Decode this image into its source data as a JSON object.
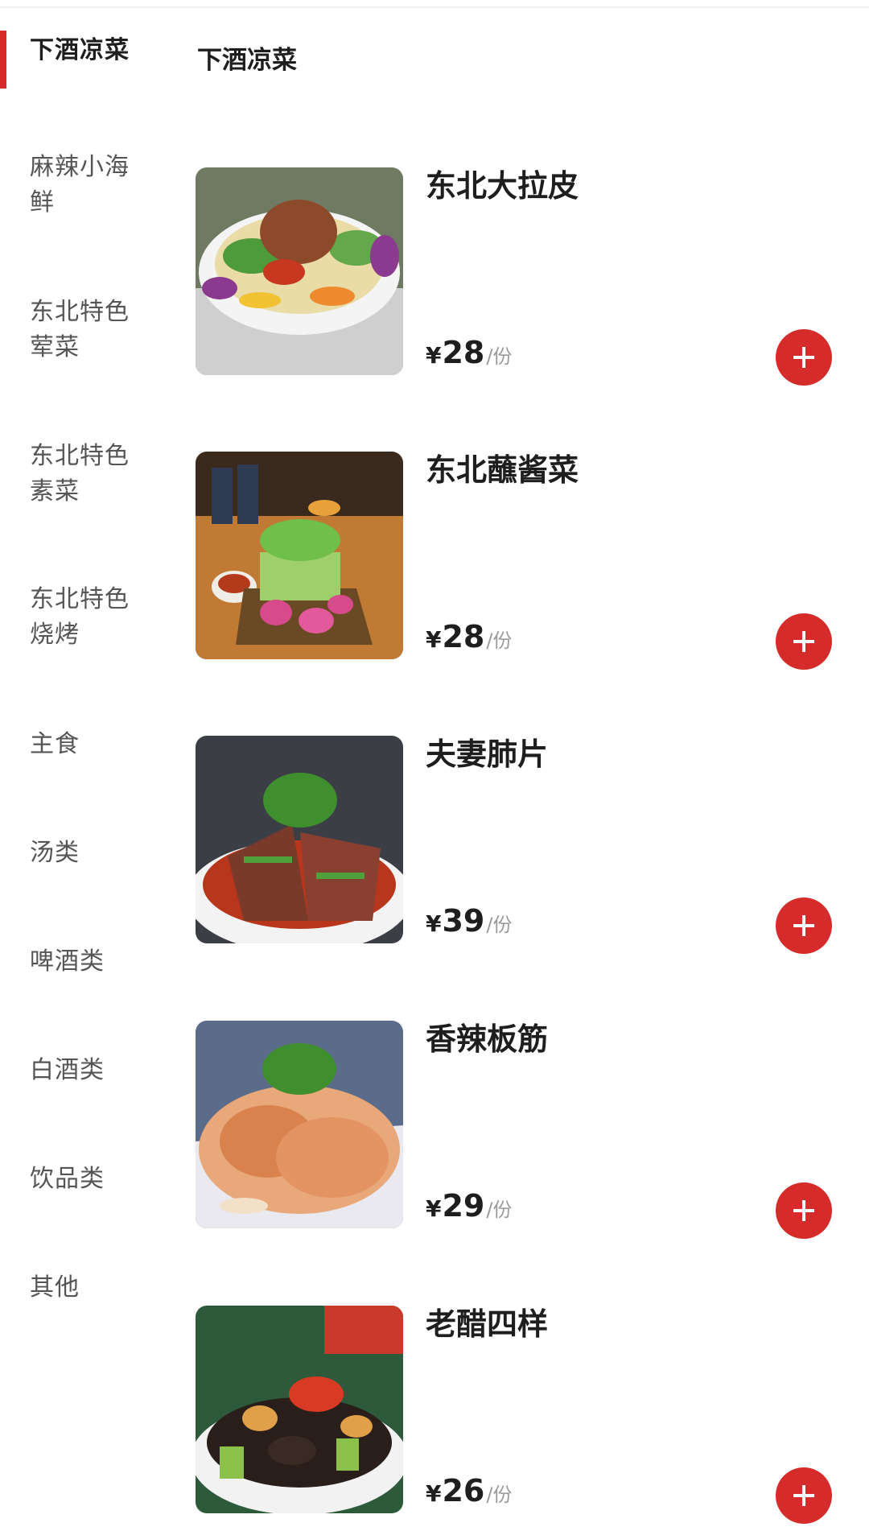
{
  "sidebar": {
    "categories": [
      {
        "label": "下酒凉菜"
      },
      {
        "label": "麻辣小海鲜"
      },
      {
        "label": "东北特色荤菜"
      },
      {
        "label": "东北特色素菜"
      },
      {
        "label": "东北特色烧烤"
      },
      {
        "label": "主食"
      },
      {
        "label": "汤类"
      },
      {
        "label": "啤酒类"
      },
      {
        "label": "白酒类"
      },
      {
        "label": "饮品类"
      },
      {
        "label": "其他"
      }
    ],
    "active_index": 0
  },
  "main": {
    "section_title": "下酒凉菜",
    "dishes": [
      {
        "name": "东北大拉皮",
        "currency": "¥",
        "price": "28",
        "unit": "/份",
        "image_icon": "dish-photo-icon"
      },
      {
        "name": "东北蘸酱菜",
        "currency": "¥",
        "price": "28",
        "unit": "/份",
        "image_icon": "dish-photo-icon"
      },
      {
        "name": "夫妻肺片",
        "currency": "¥",
        "price": "39",
        "unit": "/份",
        "image_icon": "dish-photo-icon"
      },
      {
        "name": "香辣板筋",
        "currency": "¥",
        "price": "29",
        "unit": "/份",
        "image_icon": "dish-photo-icon"
      },
      {
        "name": "老醋四样",
        "currency": "¥",
        "price": "26",
        "unit": "/份",
        "image_icon": "dish-photo-icon"
      }
    ]
  },
  "colors": {
    "accent": "#d52b2b",
    "text_primary": "#1e1e1e",
    "text_secondary": "#555555",
    "text_muted": "#9a9a9a"
  },
  "icons": {
    "add_button": "plus-icon"
  }
}
